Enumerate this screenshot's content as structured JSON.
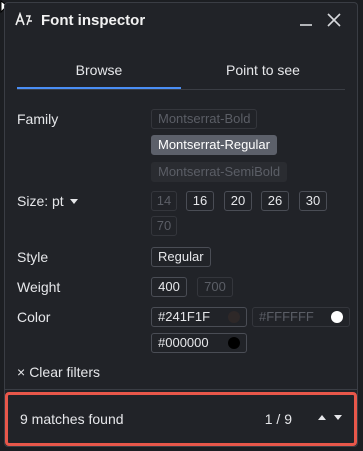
{
  "window": {
    "title": "Font inspector",
    "icon": "font-glyph-icon"
  },
  "tabs": [
    {
      "label": "Browse",
      "active": true
    },
    {
      "label": "Point to see",
      "active": false
    }
  ],
  "filters": {
    "family": {
      "label": "Family",
      "options": [
        {
          "label": "Montserrat-Bold",
          "state": "dim"
        },
        {
          "label": "Montserrat-Regular",
          "state": "selected"
        },
        {
          "label": "Montserrat-SemiBold",
          "state": "dim"
        }
      ]
    },
    "size": {
      "label": "Size: pt",
      "options": [
        "14",
        "16",
        "20",
        "26",
        "30",
        "70"
      ]
    },
    "style": {
      "label": "Style",
      "options": [
        "Regular"
      ]
    },
    "weight": {
      "label": "Weight",
      "options": [
        "400",
        "700"
      ]
    },
    "color": {
      "label": "Color",
      "options": [
        {
          "hex": "#241F1F",
          "swatch": "#241f1f"
        },
        {
          "hex": "#FFFFFF",
          "swatch": "#ffffff"
        },
        {
          "hex": "#000000",
          "swatch": "#000000"
        }
      ]
    },
    "clear_label": "Clear filters"
  },
  "footer": {
    "matches_text": "9 matches found",
    "page_text": "1 / 9"
  },
  "colors": {
    "accent": "#4a8ef5",
    "highlight_border": "#e8574a",
    "panel_bg": "#212328"
  }
}
